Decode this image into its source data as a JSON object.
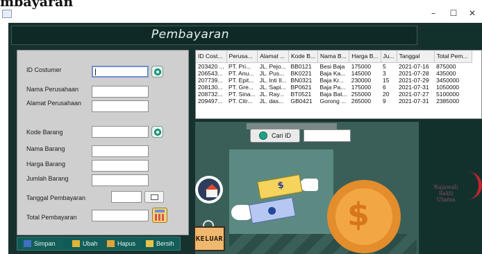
{
  "window": {
    "title": "mbayaran",
    "minimize": "–",
    "maximize": "☐",
    "close": "✕"
  },
  "header": {
    "title": "Pembayaran"
  },
  "form": {
    "id_costumer_label": "ID Costumer",
    "nama_perusahaan_label": "Nama Perusahaan",
    "alamat_perusahaan_label": "Alamat Perusahaan",
    "kode_barang_label": "Kode Barang",
    "nama_barang_label": "Nama Barang",
    "harga_barang_label": "Harga Barang",
    "jumlah_barang_label": "Jumlah Barang",
    "tanggal_pembayaran_label": "Tanggal Pembayaran",
    "total_pembayaran_label": "Total Pembayaran",
    "id_costumer_value": "",
    "nama_perusahaan_value": "",
    "alamat_perusahaan_value": "",
    "kode_barang_value": "",
    "nama_barang_value": "",
    "harga_barang_value": "",
    "jumlah_barang_value": "",
    "tanggal_pembayaran_value": "",
    "total_pembayaran_value": ""
  },
  "actions": {
    "simpan": "Simpan",
    "ubah": "Ubah",
    "hapus": "Hapus",
    "bersih": "Bersih"
  },
  "table": {
    "columns": [
      "ID Cost...",
      "Perusa...",
      "Alamat ...",
      "Kode B...",
      "Nama B...",
      "Harga B...",
      "Ju...",
      "Tanggal",
      "Total Pem..."
    ],
    "rows": [
      [
        "203420 ...",
        "PT. Pri...",
        "JL. Pejo...",
        "BB0121",
        "Besi Baja",
        "175000",
        "5",
        "2021-07-16",
        "875000"
      ],
      [
        "206543...",
        "PT. Anu...",
        "JL. Pus...",
        "BK0221",
        "Baja Ka...",
        "145000",
        "3",
        "2021-07-28",
        "435000"
      ],
      [
        "207739...",
        "PT. Epit...",
        "JL. Inti Il...",
        "BN0321",
        "Baja Kr...",
        "230000",
        "15",
        "2021-07-29",
        "3450000"
      ],
      [
        "208130...",
        "PT. Gre...",
        "JL. Sapi...",
        "BP0621",
        "Baja Pa...",
        "175000",
        "6",
        "2021-07-31",
        "1050000"
      ],
      [
        "208732...",
        "PT. Sina...",
        "JL. Ray...",
        "BT0521",
        "Baja Bat...",
        "255000",
        "20",
        "2021-07-27",
        "5100000"
      ],
      [
        "209497...",
        "PT. Citr...",
        "JL. das...",
        "GB0421",
        "Gorong ...",
        "265000",
        "9",
        "2021-07-31",
        "2385000"
      ]
    ]
  },
  "search": {
    "cari_label": "Cari ID",
    "value": ""
  },
  "keluar": {
    "label": "KELUAR"
  },
  "money": {
    "sign": "$"
  },
  "brand": {
    "line1": "Rajawali",
    "line2": "Sakti",
    "line3": "Utama"
  },
  "colors": {
    "frame_bg": "#17312e",
    "panel_gray": "#cfcfcf",
    "action_bar": "#0f5c57",
    "coin": "#f2a744"
  }
}
